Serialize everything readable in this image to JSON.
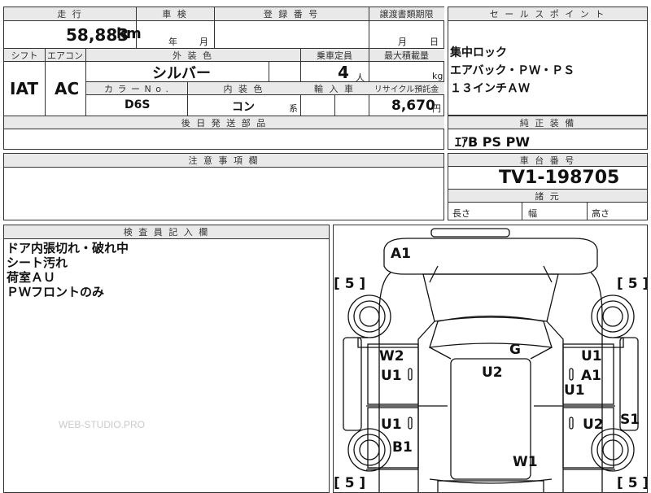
{
  "left_top": {
    "mileage_header": "走 行",
    "inspection_header": "車 検",
    "registration_header": "登 録 番 号",
    "transfer_header": "譲渡書類期限",
    "mileage_value": "58,883",
    "mileage_unit": "km",
    "inspection_year_unit": "年",
    "inspection_month_unit": "月",
    "transfer_month_unit": "月",
    "transfer_day_unit": "日",
    "shift_header": "シフト",
    "aircon_header": "エアコン",
    "exterior_color_header": "外 装 色",
    "capacity_header": "乗車定員",
    "max_load_header": "最大積載量",
    "shift_value": "IAT",
    "aircon_value": "AC",
    "exterior_color_value": "シルバー",
    "capacity_value": "4",
    "capacity_unit": "人",
    "max_load_unit": "kg",
    "color_no_header": "カ ラ ー N o .",
    "interior_color_header": "内 装 色",
    "import_header": "輸 入 車",
    "recycle_header": "リサイクル預託金",
    "color_no_value": "D6S",
    "interior_color_value": "コン",
    "interior_color_suffix": "系",
    "recycle_value": "8,670",
    "recycle_unit": "円",
    "later_parts_header": "後 日 発 送 部 品"
  },
  "sales_points": {
    "header": "セ ー ル ス ポ イ ン ト",
    "lines": [
      "集中ロック",
      "エアバック・ＰＷ・ＰＳ",
      "１３インチＡＷ"
    ]
  },
  "equipment": {
    "header": "純 正 装 備",
    "value": "ｴｱB PS PW"
  },
  "caution": {
    "header": "注 意 事 項 欄"
  },
  "chassis": {
    "header": "車 台 番 号",
    "value": "TV1-198705",
    "dims_header": "諸 元",
    "length_label": "長さ",
    "width_label": "幅",
    "height_label": "高さ"
  },
  "inspector": {
    "header": "検 査 員 記 入 欄",
    "lines": [
      "ドア内張切れ・破れ中",
      "シート汚れ",
      "荷室ＡＵ",
      "ＰＷフロントのみ"
    ]
  },
  "diagram": {
    "tire_label": "[ 5 ]",
    "codes": {
      "a1_top": "A1",
      "w2": "W2",
      "u1_left_top": "U1",
      "u1_left_bottom": "U1",
      "b1": "B1",
      "g": "G",
      "u2_center": "U2",
      "w1": "W1",
      "u1_right_top": "U1",
      "a1_right": "A1",
      "u1_right_mid": "U1",
      "u2_right": "U2",
      "s1": "S1"
    }
  },
  "watermark": "WEB-STUDIO.PRO"
}
